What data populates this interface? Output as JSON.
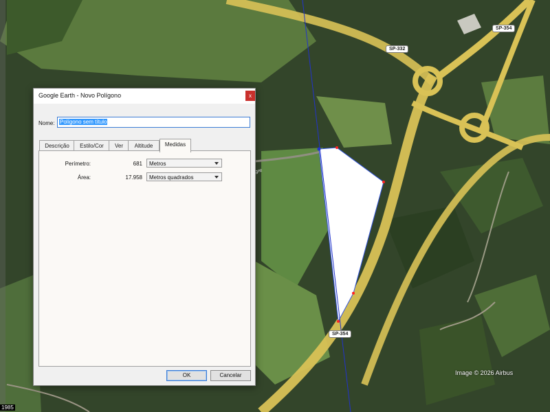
{
  "map": {
    "road_labels": [
      "SP-354",
      "SP-332",
      "SP-354"
    ],
    "copyright": "Image © 2026 Airbus",
    "year_tag": "1985",
    "partial_label": "gre"
  },
  "dialog": {
    "title": "Google Earth - Novo Polígono",
    "close_label": "x",
    "name_label": "Nome:",
    "name_value": "Polígono sem título",
    "tabs": [
      {
        "label": "Descrição",
        "active": false
      },
      {
        "label": "Estilo/Cor",
        "active": false
      },
      {
        "label": "Ver",
        "active": false
      },
      {
        "label": "Altitude",
        "active": false
      },
      {
        "label": "Medidas",
        "active": true
      }
    ],
    "measures": {
      "perimeter_label": "Perímetro:",
      "perimeter_value": "681",
      "perimeter_unit": "Metros",
      "area_label": "Área:",
      "area_value": "17.958",
      "area_unit": "Metros quadrados"
    },
    "ok_label": "OK",
    "cancel_label": "Cancelar"
  },
  "colors": {
    "polygon_fill": "#ffffff",
    "polygon_edge": "#3355dd",
    "vertex": "#ff2222",
    "road": "#d8c050"
  }
}
